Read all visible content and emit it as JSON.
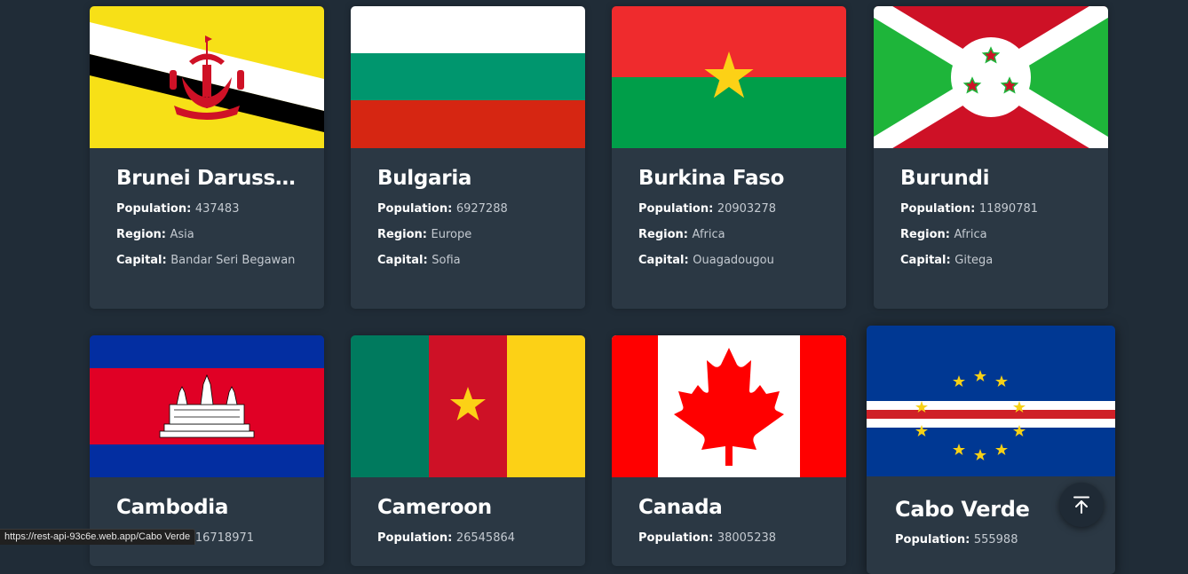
{
  "labels": {
    "population": "Population",
    "region": "Region",
    "capital": "Capital"
  },
  "countries": [
    {
      "name": "Brunei Darussalam",
      "population": "437483",
      "region": "Asia",
      "capital": "Bandar Seri Begawan"
    },
    {
      "name": "Bulgaria",
      "population": "6927288",
      "region": "Europe",
      "capital": "Sofia"
    },
    {
      "name": "Burkina Faso",
      "population": "20903278",
      "region": "Africa",
      "capital": "Ouagadougou"
    },
    {
      "name": "Burundi",
      "population": "11890781",
      "region": "Africa",
      "capital": "Gitega"
    },
    {
      "name": "Cambodia",
      "population": "16718971"
    },
    {
      "name": "Cameroon",
      "population": "26545864"
    },
    {
      "name": "Canada",
      "population": "38005238"
    },
    {
      "name": "Cabo Verde",
      "population": "555988"
    }
  ],
  "status_bar": {
    "url": "https://rest-api-93c6e.web.app/Cabo Verde"
  },
  "scroll_to_top": {
    "icon": "arrow-up-to-line-icon"
  },
  "colors": {
    "background": "#202c37",
    "card": "#2b3844",
    "text": "#ffffff",
    "muted": "#c4cad1"
  }
}
